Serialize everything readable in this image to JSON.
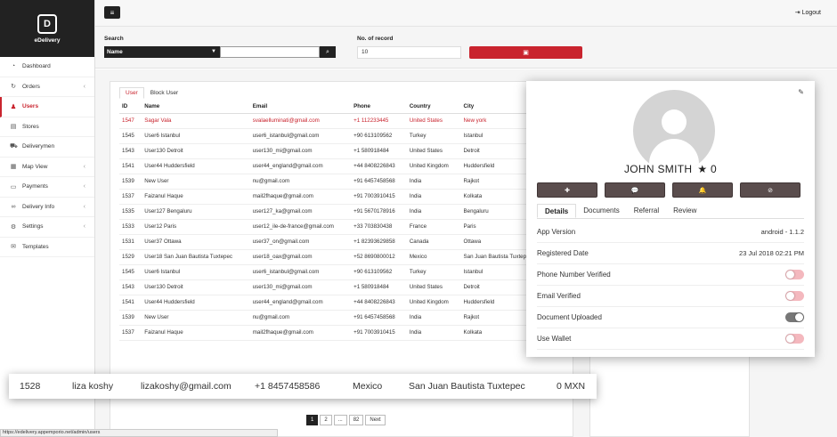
{
  "brand": {
    "name": "eDelivery",
    "logo_letter": "D"
  },
  "nav": [
    {
      "label": "Dashboard",
      "icon": "dashboard-icon",
      "glyph": "◔",
      "chev": ""
    },
    {
      "label": "Orders",
      "icon": "refresh-icon",
      "glyph": "↻",
      "chev": "‹"
    },
    {
      "label": "Users",
      "icon": "user-icon",
      "glyph": "♟",
      "chev": "",
      "active": true
    },
    {
      "label": "Stores",
      "icon": "store-icon",
      "glyph": "▤",
      "chev": ""
    },
    {
      "label": "Deliverymen",
      "icon": "truck-icon",
      "glyph": "⛟",
      "chev": ""
    },
    {
      "label": "Map View",
      "icon": "map-icon",
      "glyph": "▦",
      "chev": "‹"
    },
    {
      "label": "Payments",
      "icon": "credit-card-icon",
      "glyph": "▭",
      "chev": "‹"
    },
    {
      "label": "Delivery Info",
      "icon": "link-icon",
      "glyph": "∞",
      "chev": "‹"
    },
    {
      "label": "Settings",
      "icon": "gear-icon",
      "glyph": "⚙",
      "chev": "‹"
    },
    {
      "label": "Templates",
      "icon": "mail-icon",
      "glyph": "✉",
      "chev": ""
    }
  ],
  "topbar": {
    "menu_glyph": "≡",
    "logout": "Logout",
    "logout_glyph": "⇥"
  },
  "filters": {
    "search_label": "Search",
    "search_by": "Name",
    "search_value": "",
    "records_label": "No. of record",
    "records_value": "10"
  },
  "tabs": {
    "user": "User",
    "block": "Block User"
  },
  "table": {
    "headers": [
      "ID",
      "Name",
      "Email",
      "Phone",
      "Country",
      "City"
    ],
    "rows": [
      [
        "1547",
        "Sagar Vala",
        "svalaelluminati@gmail.com",
        "+1 112233445",
        "United States",
        "New york"
      ],
      [
        "1545",
        "User6 Istanbul",
        "user6_istanbul@gmail.com",
        "+90 613109562",
        "Turkey",
        "Istanbul"
      ],
      [
        "1543",
        "User130 Detroit",
        "user130_mi@gmail.com",
        "+1 580918484",
        "United States",
        "Detroit"
      ],
      [
        "1541",
        "User44 Huddersfield",
        "user44_england@gmail.com",
        "+44 8408226843",
        "United Kingdom",
        "Huddersfield"
      ],
      [
        "1539",
        "New User",
        "nu@gmail.com",
        "+91 6457458568",
        "India",
        "Rajkot"
      ],
      [
        "1537",
        "Faizanul Haque",
        "mail2fhaque@gmail.com",
        "+91 7003910415",
        "India",
        "Kolkata"
      ],
      [
        "1535",
        "User127 Bengaluru",
        "user127_ka@gmail.com",
        "+91 5670178916",
        "India",
        "Bengaluru"
      ],
      [
        "1533",
        "User12 Paris",
        "user12_ile-de-france@gmail.com",
        "+33 703830438",
        "France",
        "Paris"
      ],
      [
        "1531",
        "User37 Ottawa",
        "user37_on@gmail.com",
        "+1 82393629858",
        "Canada",
        "Ottawa"
      ],
      [
        "1529",
        "User18 San Juan Bautista Tuxtepec",
        "user18_oax@gmail.com",
        "+52 8690800012",
        "Mexico",
        "San Juan Bautista Tuxtepec"
      ],
      [
        "1545",
        "User6 Istanbul",
        "user6_istanbul@gmail.com",
        "+90 613109562",
        "Turkey",
        "Istanbul"
      ],
      [
        "1543",
        "User130 Detroit",
        "user130_mi@gmail.com",
        "+1 580918484",
        "United States",
        "Detroit"
      ],
      [
        "1541",
        "User44 Huddersfield",
        "user44_england@gmail.com",
        "+44 8408226843",
        "United Kingdom",
        "Huddersfield"
      ],
      [
        "1539",
        "New User",
        "nu@gmail.com",
        "+91 6457458568",
        "India",
        "Rajkot"
      ],
      [
        "1537",
        "Faizanul Haque",
        "mail2fhaque@gmail.com",
        "+91 7003910415",
        "India",
        "Kolkata"
      ]
    ]
  },
  "highlight_row": {
    "id": "1528",
    "name": "liza koshy",
    "email": "lizakoshy@gmail.com",
    "phone": "+1 8457458586",
    "country": "Mexico",
    "city": "San Juan Bautista Tuxtepec",
    "wallet": "0 MXN"
  },
  "pagination": {
    "p1": "1",
    "p2": "2",
    "ellipsis": "...",
    "last": "82",
    "next": "Next"
  },
  "status_url": "https://edelivery.appemporio.net/admin/users",
  "profile": {
    "name": "JOHN SMITH",
    "rating": "0",
    "star": "★",
    "tabs": [
      "Details",
      "Documents",
      "Referral",
      "Review"
    ],
    "details": [
      {
        "label": "App Version",
        "value": "android - 1.1.2"
      },
      {
        "label": "Registered Date",
        "value": "23 Jul 2018 02:21 PM"
      }
    ],
    "toggles": [
      {
        "label": "Phone Number Verified",
        "on": false
      },
      {
        "label": "Email Verified",
        "on": false
      },
      {
        "label": "Document Uploaded",
        "on": true
      },
      {
        "label": "Use Wallet",
        "on": false
      }
    ]
  },
  "colors": {
    "accent": "#c9242e",
    "dark": "#222222",
    "action": "#5a4d4d"
  }
}
